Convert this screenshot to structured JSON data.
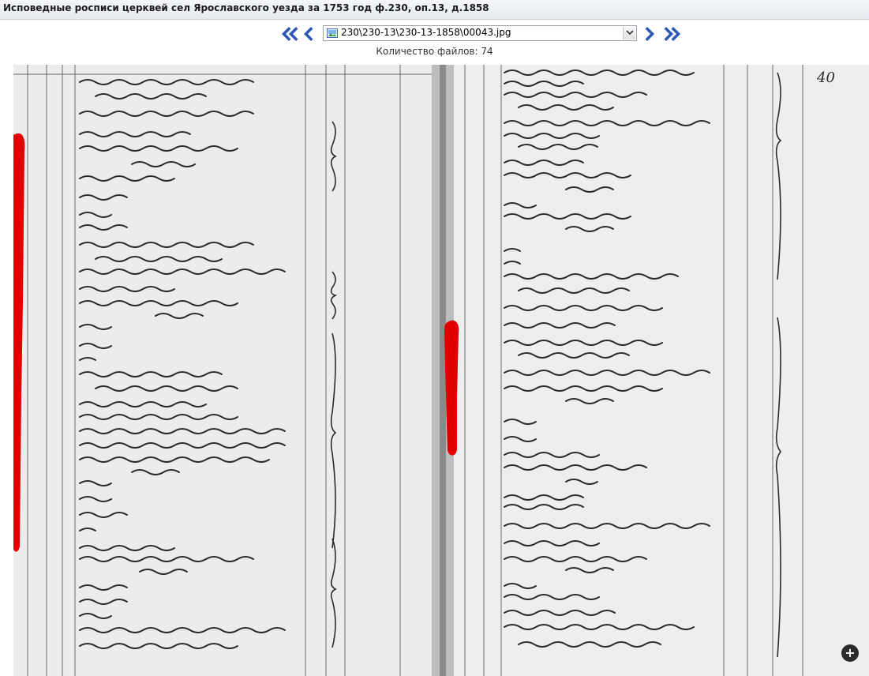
{
  "window": {
    "title": "Исповедные росписи церквей сел Ярославского уезда за 1753 год ф.230, оп.13, д.1858"
  },
  "nav": {
    "first_icon": "double-chevron-left-icon",
    "prev_icon": "chevron-left-icon",
    "next_icon": "chevron-right-icon",
    "last_icon": "double-chevron-right-icon",
    "file_select": {
      "icon": "image-file-icon",
      "value": "230\\230-13\\230-13-1858\\00043.jpg"
    },
    "file_count": "Количество файлов: 74",
    "accent_color": "#2a57b8"
  },
  "document": {
    "type": "scanned-manuscript",
    "page_number": "40",
    "annotation_color": "#e00000",
    "zoom_icon": "zoom-plus-icon"
  }
}
